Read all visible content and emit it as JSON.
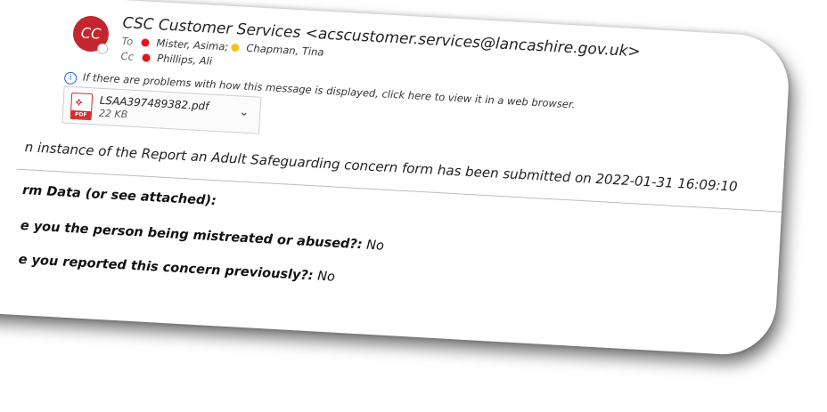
{
  "sender": {
    "avatar_initials": "CC",
    "from": "CSC Customer Services <acscustomer.services@lancashire.gov.uk>"
  },
  "recipients": {
    "to_label": "To",
    "to": [
      "Mister, Asima;",
      "Chapman, Tina"
    ],
    "cc_label": "Cc",
    "cc": [
      "Phillips, Ali"
    ]
  },
  "info_bar": {
    "text": "If there are problems with how this message is displayed, click here to view it in a web browser."
  },
  "attachment": {
    "name": "LSAA397489382.pdf",
    "size": "22 KB",
    "type_tag": "PDF"
  },
  "body": {
    "intro": "n instance of the Report an Adult Safeguarding concern form has been submitted on 2022-01-31  16:09:10",
    "form_heading": "rm Data (or see attached):",
    "q1": "e you the person being mistreated or abused?:",
    "a1": " No",
    "q2": "e you reported this concern previously?:",
    "a2": " No"
  },
  "colors": {
    "avatar": "#c4262e",
    "status_red": "#e2161d",
    "status_yellow": "#f0c419",
    "info_blue": "#1a66c8"
  }
}
